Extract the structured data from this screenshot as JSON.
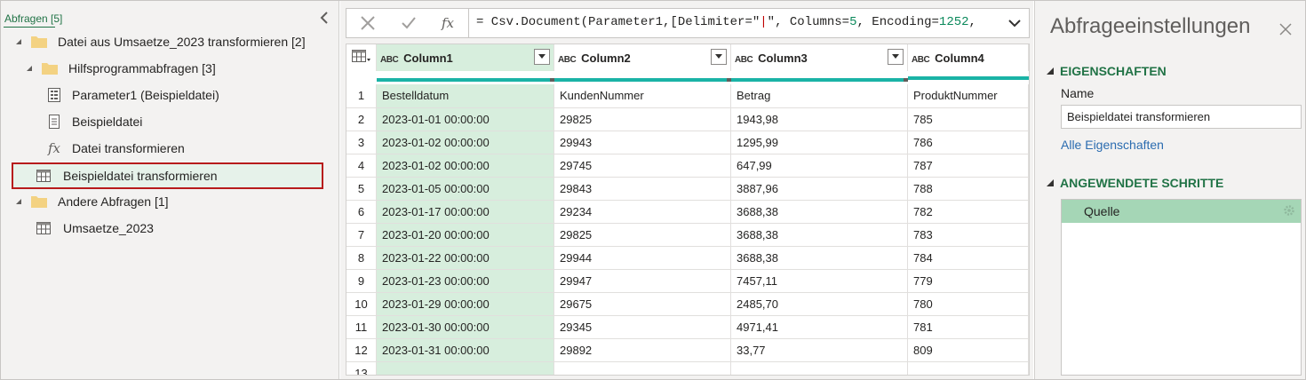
{
  "queries": {
    "header": "Abfragen [5]",
    "items": [
      {
        "label": "Datei aus Umsaetze_2023 transformieren [2]",
        "type": "folder"
      },
      {
        "label": "Hilfsprogrammabfragen [3]",
        "type": "folder"
      },
      {
        "label": "Parameter1 (Beispieldatei)",
        "type": "parameter"
      },
      {
        "label": "Beispieldatei",
        "type": "file"
      },
      {
        "label": "Datei transformieren",
        "type": "function"
      },
      {
        "label": "Beispieldatei transformieren",
        "type": "table"
      },
      {
        "label": "Andere Abfragen [1]",
        "type": "folder"
      },
      {
        "label": "Umsaetze_2023",
        "type": "table"
      }
    ]
  },
  "formula_bar": {
    "fx": "fx",
    "part1": "= Csv.Document(Parameter1,[Delimiter=\"",
    "pipe": "|",
    "part2": "\", Columns=",
    "n1": "5",
    "part3": ", Encoding=",
    "n2": "1252",
    "part4": ","
  },
  "grid": {
    "type_badge": "ABC",
    "columns": [
      "Column1",
      "Column2",
      "Column3",
      "Column4"
    ],
    "rows": [
      {
        "n": "1",
        "c": [
          "Bestelldatum",
          "KundenNummer",
          "Betrag",
          "ProduktNummer"
        ]
      },
      {
        "n": "2",
        "c": [
          "2023-01-01 00:00:00",
          "29825",
          "1943,98",
          "785"
        ]
      },
      {
        "n": "3",
        "c": [
          "2023-01-02 00:00:00",
          "29943",
          "1295,99",
          "786"
        ]
      },
      {
        "n": "4",
        "c": [
          "2023-01-02 00:00:00",
          "29745",
          "647,99",
          "787"
        ]
      },
      {
        "n": "5",
        "c": [
          "2023-01-05 00:00:00",
          "29843",
          "3887,96",
          "788"
        ]
      },
      {
        "n": "6",
        "c": [
          "2023-01-17 00:00:00",
          "29234",
          "3688,38",
          "782"
        ]
      },
      {
        "n": "7",
        "c": [
          "2023-01-20 00:00:00",
          "29825",
          "3688,38",
          "783"
        ]
      },
      {
        "n": "8",
        "c": [
          "2023-01-22 00:00:00",
          "29944",
          "3688,38",
          "784"
        ]
      },
      {
        "n": "9",
        "c": [
          "2023-01-23 00:00:00",
          "29947",
          "7457,11",
          "779"
        ]
      },
      {
        "n": "10",
        "c": [
          "2023-01-29 00:00:00",
          "29675",
          "2485,70",
          "780"
        ]
      },
      {
        "n": "11",
        "c": [
          "2023-01-30 00:00:00",
          "29345",
          "4971,41",
          "781"
        ]
      },
      {
        "n": "12",
        "c": [
          "2023-01-31 00:00:00",
          "29892",
          "33,77",
          "809"
        ]
      },
      {
        "n": "13",
        "c": [
          "",
          "",
          "",
          ""
        ]
      }
    ]
  },
  "settings": {
    "title": "Abfrageeinstellungen",
    "properties_title": "EIGENSCHAFTEN",
    "name_label": "Name",
    "name_value": "Beispieldatei transformieren",
    "all_properties": "Alle Eigenschaften",
    "steps_title": "ANGEWENDETE SCHRITTE",
    "steps": [
      "Quelle"
    ]
  },
  "colors": {
    "accent_green": "#217346",
    "selection_border": "#b71c1c",
    "column_highlight": "#d7eedd",
    "quality_bar": "#1ab3a6"
  }
}
